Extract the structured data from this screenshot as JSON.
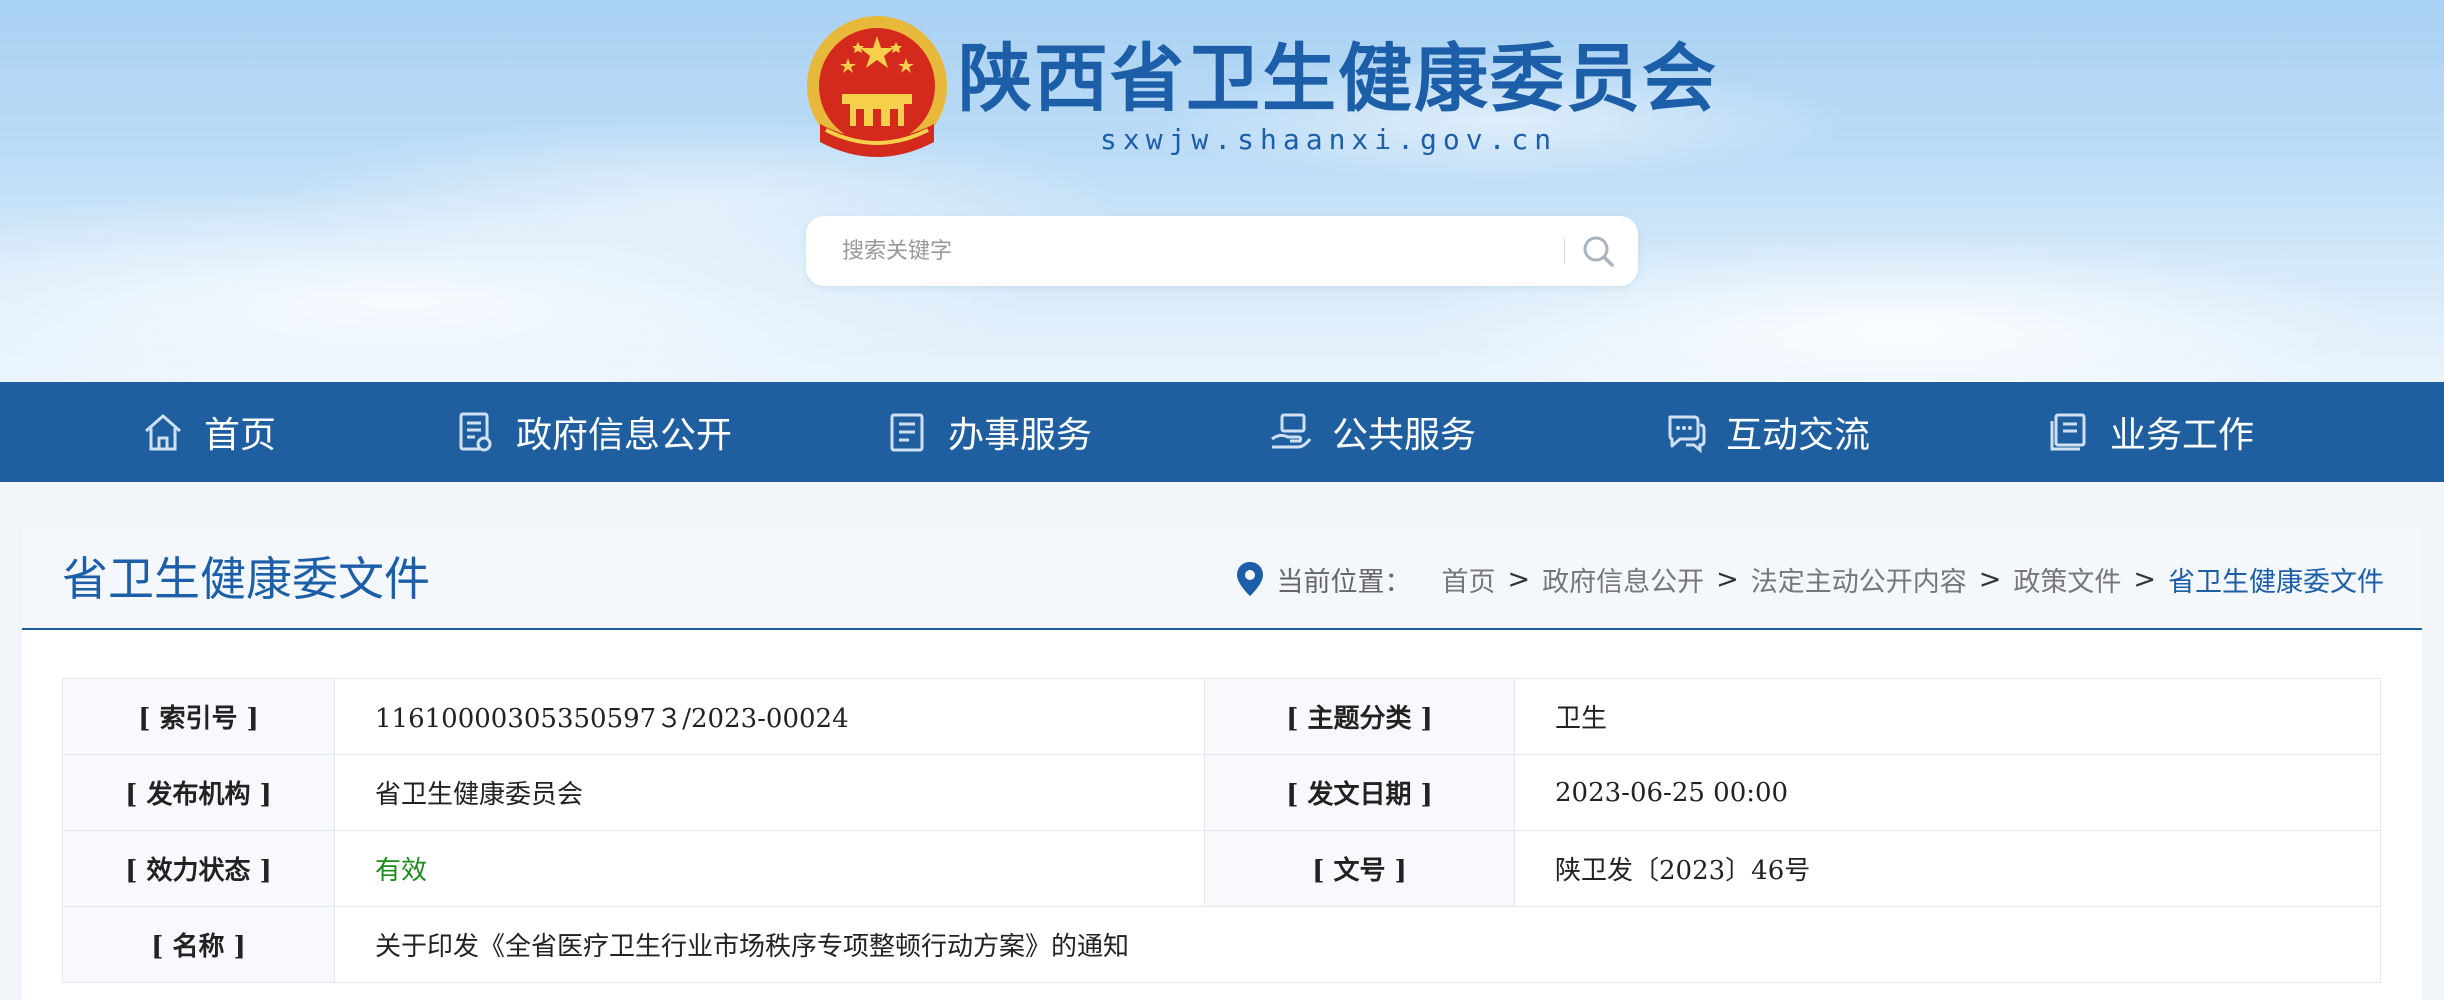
{
  "header": {
    "site_title": "陕西省卫生健康委员会",
    "site_domain": "sxwjw.shaanxi.gov.cn",
    "emblem_icon": "national-emblem-icon"
  },
  "search": {
    "placeholder": "搜索关键字",
    "icon": "search-icon"
  },
  "nav": {
    "items": [
      {
        "label": "首页",
        "icon": "home-icon"
      },
      {
        "label": "政府信息公开",
        "icon": "document-icon"
      },
      {
        "label": "办事服务",
        "icon": "clipboard-icon"
      },
      {
        "label": "公共服务",
        "icon": "hand-service-icon"
      },
      {
        "label": "互动交流",
        "icon": "chat-icon"
      },
      {
        "label": "业务工作",
        "icon": "book-icon"
      }
    ]
  },
  "panel": {
    "title": "省卫生健康委文件",
    "breadcrumb": {
      "label": "当前位置：",
      "items": [
        "首页",
        "政府信息公开",
        "法定主动公开内容",
        "政策文件"
      ],
      "current": "省卫生健康委文件",
      "separator": ">"
    }
  },
  "meta": {
    "index_label": "[ 索引号 ]",
    "index_value": "11610000305350597３/2023-00024",
    "topic_label": "[ 主题分类 ]",
    "topic_value": "卫生",
    "org_label": "[ 发布机构 ]",
    "org_value": "省卫生健康委员会",
    "date_label": "[ 发文日期 ]",
    "date_value": "2023-06-25 00:00",
    "status_label": "[ 效力状态 ]",
    "status_value": "有效",
    "docno_label": "[ 文号 ]",
    "docno_value": "陕卫发〔2023〕46号",
    "name_label": "[ 名称 ]",
    "name_value": "关于印发《全省医疗卫生行业市场秩序专项整顿行动方案》的通知"
  },
  "colors": {
    "brand_blue": "#1f5fa0",
    "title_blue": "#1d5ea8",
    "valid_green": "#1b8a1b"
  }
}
